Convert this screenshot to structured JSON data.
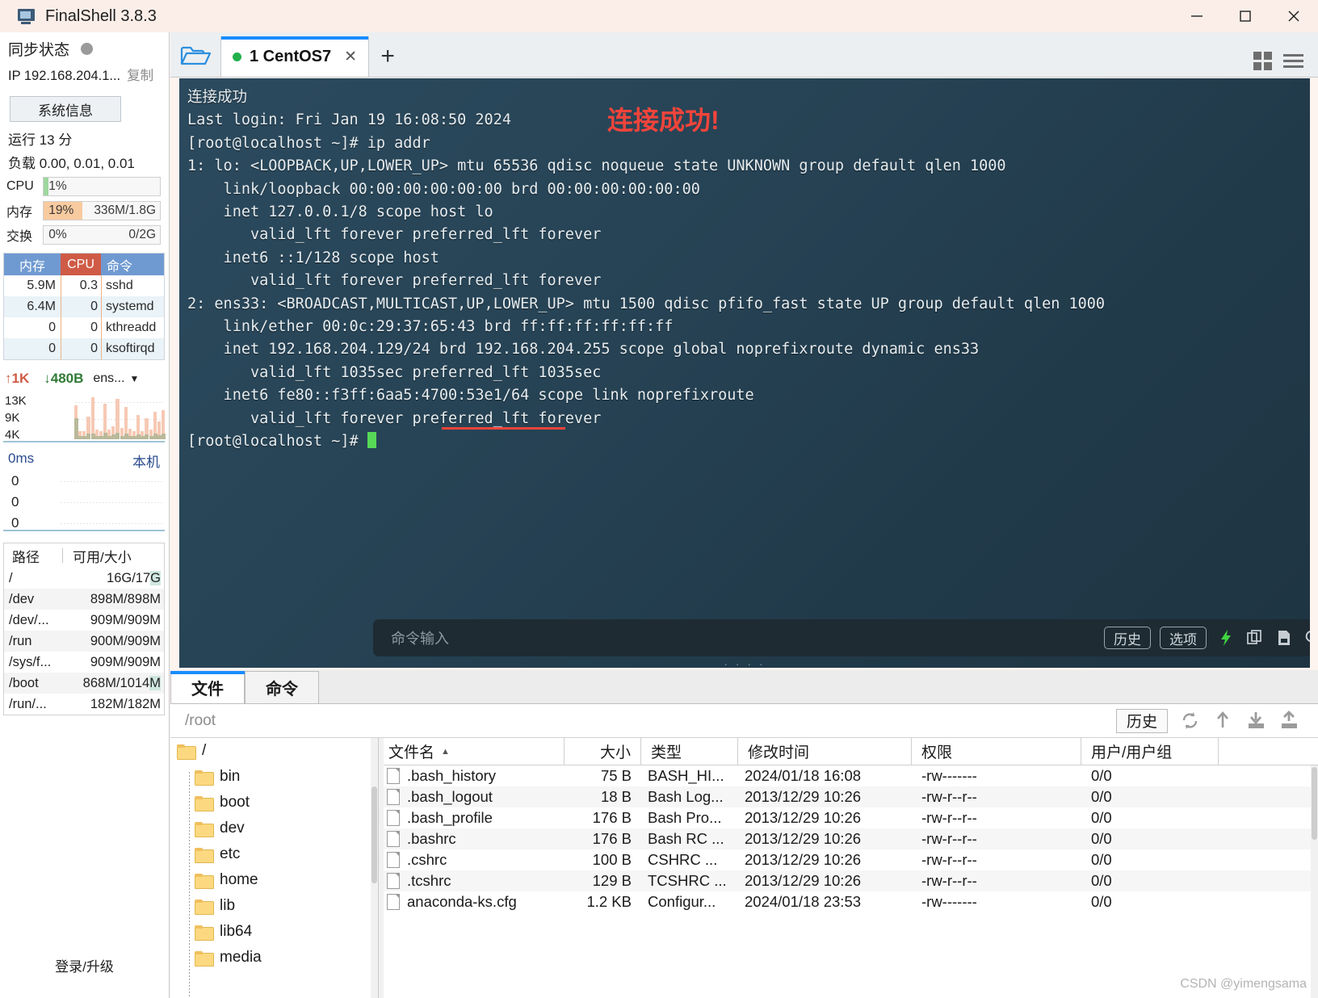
{
  "window": {
    "title": "FinalShell 3.8.3",
    "minimize": "─",
    "maximize": "□",
    "close": "✕"
  },
  "sidebar": {
    "sync_label": "同步状态",
    "ip_label": "IP 192.168.204.1...",
    "copy_label": "复制",
    "sysinfo_button": "系统信息",
    "uptime": "运行 13 分",
    "load": "负载 0.00, 0.01, 0.01",
    "meters": [
      {
        "name": "CPU",
        "percent": "1%",
        "detail": "",
        "fill_pct": 4,
        "color": "#9fd79f"
      },
      {
        "name": "内存",
        "percent": "19%",
        "detail": "336M/1.8G",
        "fill_pct": 33,
        "color": "#f8ca9f"
      },
      {
        "name": "交换",
        "percent": "0%",
        "detail": "0/2G",
        "fill_pct": 0,
        "color": "#f8ca9f"
      }
    ],
    "proc_headers": [
      "内存",
      "CPU",
      "命令"
    ],
    "proc_rows": [
      {
        "mem": "5.9M",
        "cpu": "0.3",
        "cmd": "sshd"
      },
      {
        "mem": "6.4M",
        "cpu": "0",
        "cmd": "systemd"
      },
      {
        "mem": "0",
        "cpu": "0",
        "cmd": "kthreadd"
      },
      {
        "mem": "0",
        "cpu": "0",
        "cmd": "ksoftirqd"
      }
    ],
    "net": {
      "up": "1K",
      "down": "480B",
      "iface": "ens...",
      "y_labels": [
        "13K",
        "9K",
        "4K"
      ],
      "bars": [
        42,
        10,
        10,
        28,
        52,
        12,
        10,
        44,
        12,
        16,
        50,
        14,
        40,
        13,
        10,
        30,
        10,
        26,
        12,
        34,
        22,
        36
      ],
      "bars_green": [
        26,
        4,
        4,
        7,
        7,
        4,
        4,
        8,
        4,
        6,
        8,
        4,
        7,
        4,
        4,
        6,
        4,
        6,
        4,
        7,
        5,
        7
      ]
    },
    "ping": {
      "top_left": "0ms",
      "top_right": "本机",
      "rows": [
        "0",
        "0",
        "0"
      ]
    },
    "disk_headers": [
      "路径",
      "可用/大小"
    ],
    "disk_rows": [
      {
        "path": "/",
        "value": "16G/17G",
        "hl": true
      },
      {
        "path": "/dev",
        "value": "898M/898M",
        "hl": false
      },
      {
        "path": "/dev/...",
        "value": "909M/909M",
        "hl": false
      },
      {
        "path": "/run",
        "value": "900M/909M",
        "hl": false
      },
      {
        "path": "/sys/f...",
        "value": "909M/909M",
        "hl": false
      },
      {
        "path": "/boot",
        "value": "868M/1014M",
        "hl": true
      },
      {
        "path": "/run/...",
        "value": "182M/182M",
        "hl": false
      }
    ],
    "login_link": "登录/升级"
  },
  "tabbar": {
    "folder_icon": "open-folder-icon",
    "tab_label": "1 CentOS7",
    "tab_close": "✕",
    "new_tab": "+",
    "grid_icon": "grid-view-icon",
    "menu_icon": "hamburger-menu-icon"
  },
  "terminal": {
    "watermark": "连接成功!",
    "lines": [
      "连接成功",
      "Last login: Fri Jan 19 16:08:50 2024",
      "[root@localhost ~]# ip addr",
      "1: lo: <LOOPBACK,UP,LOWER_UP> mtu 65536 qdisc noqueue state UNKNOWN group default qlen 1000",
      "    link/loopback 00:00:00:00:00:00 brd 00:00:00:00:00:00",
      "    inet 127.0.0.1/8 scope host lo",
      "       valid_lft forever preferred_lft forever",
      "    inet6 ::1/128 scope host",
      "       valid_lft forever preferred_lft forever",
      "2: ens33: <BROADCAST,MULTICAST,UP,LOWER_UP> mtu 1500 qdisc pfifo_fast state UP group default qlen 1000",
      "    link/ether 00:0c:29:37:65:43 brd ff:ff:ff:ff:ff:ff",
      "    inet 192.168.204.129/24 brd 192.168.204.255 scope global noprefixroute dynamic ens33",
      "       valid_lft 1035sec preferred_lft 1035sec",
      "    inet6 fe80::f3ff:6aa5:4700:53e1/64 scope link noprefixroute",
      "       valid_lft forever preferred_lft forever"
    ],
    "prompt": "[root@localhost ~]# ",
    "cmd_placeholder": "命令输入",
    "history_button": "历史",
    "options_button": "选项",
    "icons": [
      "lightning-icon",
      "copy-icon",
      "paste-icon",
      "search-icon",
      "gear-icon",
      "download-icon",
      "window-icon"
    ]
  },
  "bottom": {
    "tabs": [
      {
        "label": "文件",
        "active": true
      },
      {
        "label": "命令",
        "active": false
      }
    ],
    "path": "/root",
    "history_button": "历史",
    "tool_icons": [
      "refresh-icon",
      "upload-arrow-icon",
      "download-file-icon",
      "upload-file-icon"
    ],
    "tree": [
      {
        "label": "/",
        "level": 0
      },
      {
        "label": "bin",
        "level": 1
      },
      {
        "label": "boot",
        "level": 1
      },
      {
        "label": "dev",
        "level": 1
      },
      {
        "label": "etc",
        "level": 1
      },
      {
        "label": "home",
        "level": 1
      },
      {
        "label": "lib",
        "level": 1
      },
      {
        "label": "lib64",
        "level": 1
      },
      {
        "label": "media",
        "level": 1
      }
    ],
    "columns": [
      "文件名",
      "大小",
      "类型",
      "修改时间",
      "权限",
      "用户/用户组"
    ],
    "sort_caret": "▲",
    "files": [
      {
        "name": ".bash_history",
        "size": "75 B",
        "type": "BASH_HI...",
        "mtime": "2024/01/18 16:08",
        "perm": "-rw-------",
        "owner": "0/0"
      },
      {
        "name": ".bash_logout",
        "size": "18 B",
        "type": "Bash Log...",
        "mtime": "2013/12/29 10:26",
        "perm": "-rw-r--r--",
        "owner": "0/0"
      },
      {
        "name": ".bash_profile",
        "size": "176 B",
        "type": "Bash Pro...",
        "mtime": "2013/12/29 10:26",
        "perm": "-rw-r--r--",
        "owner": "0/0"
      },
      {
        "name": ".bashrc",
        "size": "176 B",
        "type": "Bash RC ...",
        "mtime": "2013/12/29 10:26",
        "perm": "-rw-r--r--",
        "owner": "0/0"
      },
      {
        "name": ".cshrc",
        "size": "100 B",
        "type": "CSHRC ...",
        "mtime": "2013/12/29 10:26",
        "perm": "-rw-r--r--",
        "owner": "0/0"
      },
      {
        "name": ".tcshrc",
        "size": "129 B",
        "type": "TCSHRC ...",
        "mtime": "2013/12/29 10:26",
        "perm": "-rw-r--r--",
        "owner": "0/0"
      },
      {
        "name": "anaconda-ks.cfg",
        "size": "1.2 KB",
        "type": "Configur...",
        "mtime": "2024/01/18 23:53",
        "perm": "-rw-------",
        "owner": "0/0"
      }
    ],
    "watermark": "CSDN @yimengsama"
  }
}
